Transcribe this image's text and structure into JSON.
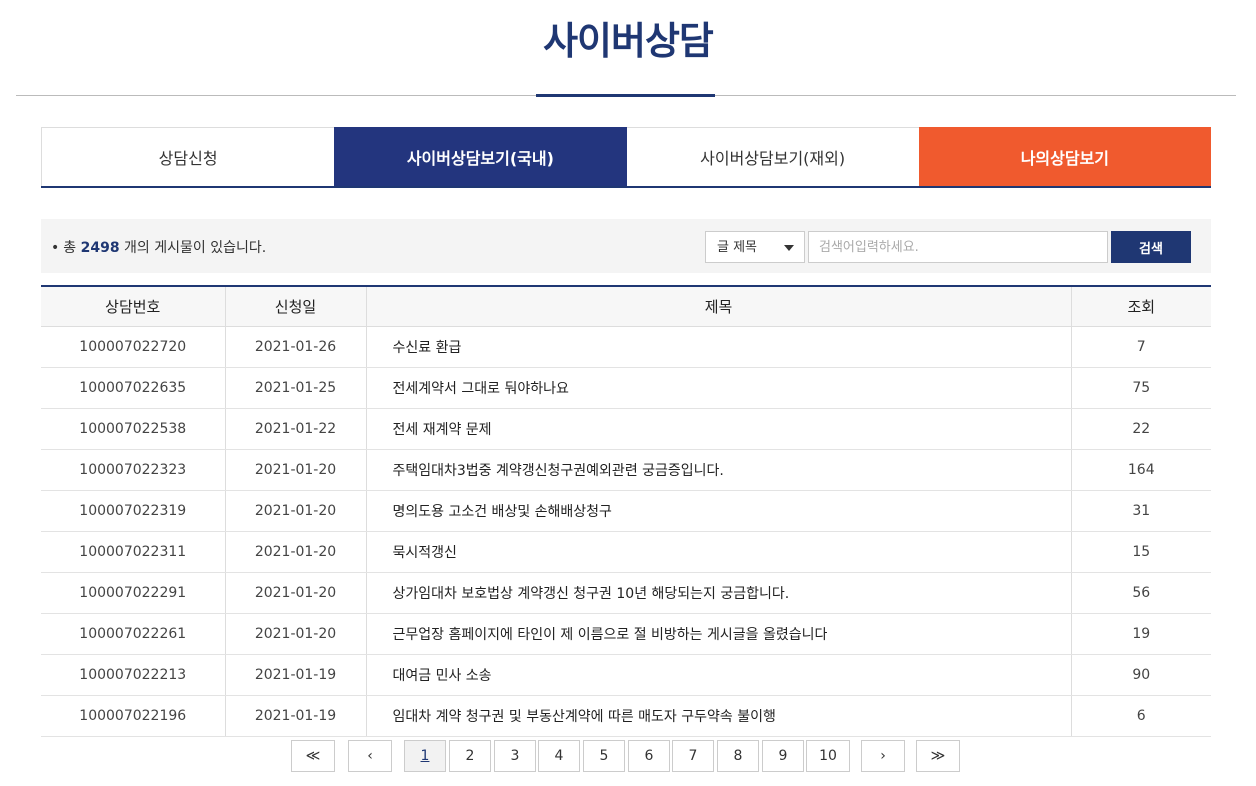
{
  "page": {
    "title": "사이버상담"
  },
  "tabs": [
    {
      "label": "상담신청"
    },
    {
      "label": "사이버상담보기(국내)"
    },
    {
      "label": "사이버상담보기(재외)"
    },
    {
      "label": "나의상담보기"
    }
  ],
  "search": {
    "count_prefix": "총",
    "count_value": "2498",
    "count_suffix": "개의 게시물이 있습니다.",
    "select_value": "글 제목",
    "placeholder": "검색어입력하세요.",
    "button_label": "검색"
  },
  "table": {
    "headers": [
      "상담번호",
      "신청일",
      "제목",
      "조회"
    ],
    "rows": [
      [
        "100007022720",
        "2021-01-26",
        "수신료 환급",
        "7"
      ],
      [
        "100007022635",
        "2021-01-25",
        "전세계약서 그대로 둬야하나요",
        "75"
      ],
      [
        "100007022538",
        "2021-01-22",
        "전세 재계약 문제",
        "22"
      ],
      [
        "100007022323",
        "2021-01-20",
        "주택임대차3법중 계약갱신청구권예외관련 궁금증입니다.",
        "164"
      ],
      [
        "100007022319",
        "2021-01-20",
        "명의도용 고소건 배상및 손해배상청구",
        "31"
      ],
      [
        "100007022311",
        "2021-01-20",
        "묵시적갱신",
        "15"
      ],
      [
        "100007022291",
        "2021-01-20",
        "상가임대차 보호법상 계약갱신 청구권 10년 해당되는지 궁금합니다.",
        "56"
      ],
      [
        "100007022261",
        "2021-01-20",
        "근무업장 홈페이지에 타인이 제 이름으로 절 비방하는 게시글을 올렸습니다",
        "19"
      ],
      [
        "100007022213",
        "2021-01-19",
        "대여금 민사 소송",
        "90"
      ],
      [
        "100007022196",
        "2021-01-19",
        "임대차 계약 청구권 및 부동산계약에 따른 매도자 구두약속 불이행",
        "6"
      ]
    ]
  },
  "pagination": {
    "first": "≪",
    "prev": "‹",
    "pages": [
      "1",
      "2",
      "3",
      "4",
      "5",
      "6",
      "7",
      "8",
      "9",
      "10"
    ],
    "current": "1",
    "next": "›",
    "last": "≫"
  },
  "colors": {
    "primary": "#1f3773",
    "tab_active": "#23357e",
    "tab_highlight": "#f05a2e"
  }
}
